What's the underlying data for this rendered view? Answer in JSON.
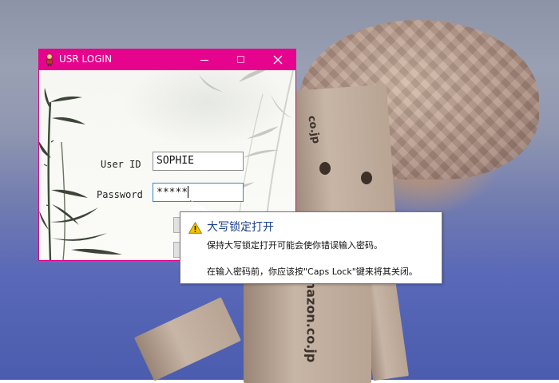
{
  "window": {
    "title": "USR LOGIN",
    "title_color": "#e6048e",
    "icons": {
      "app": "user-figure-icon",
      "minimize": "minimize-icon",
      "maximize": "maximize-icon",
      "close": "close-icon"
    }
  },
  "form": {
    "user_label": "User ID",
    "user_value": "SOPHIE",
    "password_label": "Password",
    "password_value": "*****"
  },
  "tooltip": {
    "icon": "warning-icon",
    "title": "大写锁定打开",
    "line1": "保持大写锁定打开可能会使你错误输入密码。",
    "line2": "在输入密码前，你应该按\"Caps Lock\"键来将其关闭。"
  },
  "wallpaper": {
    "printed_text_1": "co.jp",
    "printed_text_2": "amazon.co.jp"
  }
}
